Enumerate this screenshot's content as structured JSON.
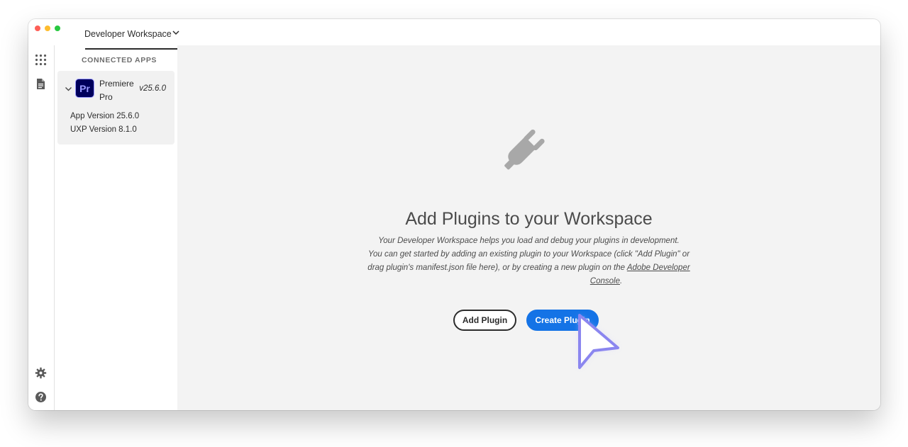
{
  "window": {
    "workspace_tab": "Developer Workspace"
  },
  "sidebar": {
    "heading": "CONNECTED APPS",
    "app": {
      "logo_text": "Pr",
      "name": "Premiere Pro",
      "version": "v25.6.0",
      "app_version": "App Version 25.6.0",
      "uxp_version": "UXP Version 8.1.0"
    }
  },
  "main": {
    "title": "Add Plugins to your Workspace",
    "desc_line1": "Your Developer Workspace helps you load and debug your plugins in development.",
    "desc_line2": "You can get started by adding an existing plugin to your Workspace (click \"Add Plugin\" or",
    "desc_line3": "drag plugin's manifest.json file here), or by creating a new plugin on the ",
    "desc_link_part1": "Adobe Developer",
    "desc_link_part2": "Console",
    "desc_end": ".",
    "add_plugin_label": "Add Plugin",
    "create_plugin_label": "Create Plugin"
  },
  "colors": {
    "primary_button": "#1473e6",
    "premiere_logo_bg": "#00005b",
    "premiere_logo_fg": "#9999ff",
    "cursor": "#8b86ef"
  },
  "icons": {
    "rail_top": "apps-grid-icon",
    "rail_second": "document-icon",
    "rail_bottom1": "gear-icon",
    "rail_bottom2": "help-icon",
    "hero": "plug-icon"
  }
}
